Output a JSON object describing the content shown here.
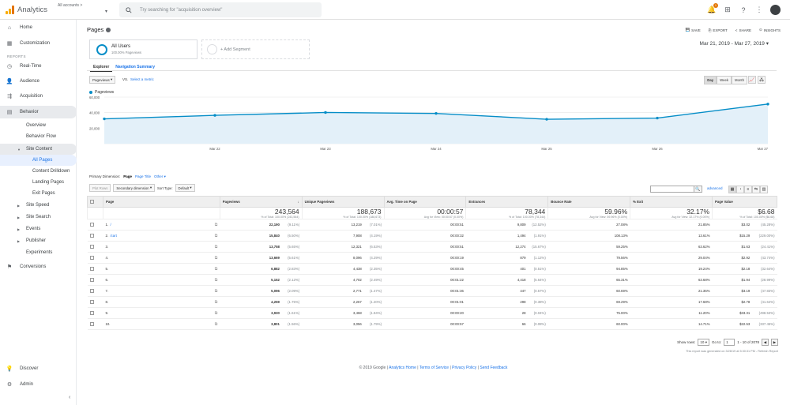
{
  "app": {
    "title": "Analytics",
    "account": "All accounts >"
  },
  "search": {
    "placeholder": "Try searching for \"acquisition overview\""
  },
  "topbar": {
    "badge_count": "1"
  },
  "sidebar": {
    "home": "Home",
    "customization": "Customization",
    "reports_heading": "REPORTS",
    "realtime": "Real-Time",
    "audience": "Audience",
    "acquisition": "Acquisition",
    "behavior": "Behavior",
    "overview": "Overview",
    "behavior_flow": "Behavior Flow",
    "site_content": "Site Content",
    "all_pages": "All Pages",
    "content_drilldown": "Content Drilldown",
    "landing_pages": "Landing Pages",
    "exit_pages": "Exit Pages",
    "site_speed": "Site Speed",
    "site_search": "Site Search",
    "events": "Events",
    "publisher": "Publisher",
    "experiments": "Experiments",
    "conversions": "Conversions",
    "discover": "Discover",
    "admin": "Admin"
  },
  "header": {
    "title": "Pages",
    "save": "SAVE",
    "export": "EXPORT",
    "share": "SHARE",
    "insights": "INSIGHTS",
    "date_range": "Mar 21, 2019 - Mar 27, 2019"
  },
  "segments": {
    "current_name": "All Users",
    "current_sub": "100.00% Pageviews",
    "add_label": "+ Add Segment"
  },
  "tabs": {
    "explorer": "Explorer",
    "navigation_summary": "Navigation Summary"
  },
  "controls": {
    "metric": "Pageviews",
    "vs": "VS.",
    "select_metric": "Select a metric",
    "day": "Day",
    "week": "Week",
    "month": "Month"
  },
  "chart_data": {
    "type": "line",
    "series": [
      {
        "name": "Pageviews",
        "values": [
          32000,
          36500,
          40200,
          39000,
          31500,
          33000,
          51000
        ],
        "color": "#058dc7"
      }
    ],
    "x": [
      "Mar 21",
      "Mar 22",
      "Mar 23",
      "Mar 24",
      "Mar 25",
      "Mar 26",
      "Mar 27"
    ],
    "x_tick_labels": [
      "Mar 22",
      "Mar 23",
      "Mar 24",
      "Mar 25",
      "Mar 26",
      "Mar 27"
    ],
    "y_ticks": [
      "60,000",
      "40,000",
      "20,000"
    ],
    "ylim": [
      0,
      60000
    ],
    "area": true,
    "grid": true
  },
  "dims": {
    "primary_label": "Primary Dimension:",
    "page": "Page",
    "page_title": "Page Title",
    "other": "Other"
  },
  "tools": {
    "plot_rows": "Plot Rows",
    "secondary": "Secondary dimension",
    "sort_label": "Sort Type:",
    "sort_value": "Default",
    "advanced": "advanced"
  },
  "table": {
    "headers": {
      "page": "Page",
      "pageviews": "Pageviews",
      "unique": "Unique Pageviews",
      "avg_time": "Avg. Time on Page",
      "entrances": "Entrances",
      "bounce": "Bounce Rate",
      "exit": "% Exit",
      "value": "Page Value"
    },
    "totals": {
      "pageviews": "243,564",
      "pageviews_sub": "% of Total: 100.00% (243,564)",
      "unique": "188,673",
      "unique_sub": "% of Total: 100.00% (188,673)",
      "avg_time": "00:00:57",
      "avg_time_sub": "Avg for View: 00:00:57 (0.00%)",
      "entrances": "78,344",
      "entrances_sub": "% of Total: 100.00% (78,344)",
      "bounce": "59.96%",
      "bounce_sub": "Avg for View: 59.96% (0.00%)",
      "exit": "32.17%",
      "exit_sub": "Avg for View: 32.17% (0.00%)",
      "value": "$6.68",
      "value_sub": "% of Total: 100.00% ($6.68)"
    },
    "rows": [
      {
        "n": "1.",
        "page": "/",
        "pv": "22,190",
        "pvp": "(9.11%)",
        "up": "13,219",
        "upp": "(7.01%)",
        "time": "00:00:51",
        "ent": "9,809",
        "entp": "(12.52%)",
        "br": "27.08%",
        "ex": "21.85%",
        "val": "$3.02",
        "valp": "(45.28%)"
      },
      {
        "n": "2.",
        "page": "/cart",
        "pv": "15,840",
        "pvp": "(6.50%)",
        "up": "7,908",
        "upp": "(4.19%)",
        "time": "00:00:32",
        "ent": "1,494",
        "entp": "(1.91%)",
        "br": "108.13%",
        "ex": "13.61%",
        "val": "$15.29",
        "valp": "(229.00%)"
      },
      {
        "n": "3.",
        "page": "",
        "pv": "13,758",
        "pvp": "(5.65%)",
        "up": "12,321",
        "upp": "(6.53%)",
        "time": "00:00:51",
        "ent": "12,274",
        "entp": "(15.67%)",
        "br": "59.25%",
        "ex": "63.62%",
        "val": "$1.63",
        "valp": "(24.41%)"
      },
      {
        "n": "4.",
        "page": "",
        "pv": "13,669",
        "pvp": "(5.61%)",
        "up": "8,096",
        "upp": "(4.29%)",
        "time": "00:00:19",
        "ent": "879",
        "entp": "(1.12%)",
        "br": "79.56%",
        "ex": "29.04%",
        "val": "$2.92",
        "valp": "(43.74%)"
      },
      {
        "n": "5.",
        "page": "",
        "pv": "6,882",
        "pvp": "(2.83%)",
        "up": "4,438",
        "upp": "(2.35%)",
        "time": "00:00:45",
        "ent": "401",
        "entp": "(0.51%)",
        "br": "94.85%",
        "ex": "19.24%",
        "val": "$2.18",
        "valp": "(32.64%)"
      },
      {
        "n": "6.",
        "page": "",
        "pv": "5,152",
        "pvp": "(2.12%)",
        "up": "4,702",
        "upp": "(2.49%)",
        "time": "00:01:22",
        "ent": "4,418",
        "entp": "(5.64%)",
        "br": "65.31%",
        "ex": "63.68%",
        "val": "$1.94",
        "valp": "(28.99%)"
      },
      {
        "n": "7.",
        "page": "",
        "pv": "5,096",
        "pvp": "(2.09%)",
        "up": "2,771",
        "upp": "(1.47%)",
        "time": "00:01:36",
        "ent": "447",
        "entp": "(0.57%)",
        "br": "60.69%",
        "ex": "21.35%",
        "val": "$3.19",
        "valp": "(47.83%)"
      },
      {
        "n": "8.",
        "page": "",
        "pv": "4,259",
        "pvp": "(1.75%)",
        "up": "2,267",
        "upp": "(1.20%)",
        "time": "00:01:01",
        "ent": "298",
        "entp": "(0.38%)",
        "br": "69.29%",
        "ex": "17.68%",
        "val": "$2.78",
        "valp": "(41.64%)"
      },
      {
        "n": "9.",
        "page": "",
        "pv": "3,930",
        "pvp": "(1.61%)",
        "up": "3,468",
        "upp": "(1.84%)",
        "time": "00:00:20",
        "ent": "28",
        "entp": "(0.04%)",
        "br": "75.00%",
        "ex": "11.20%",
        "val": "$33.31",
        "valp": "(498.53%)"
      },
      {
        "n": "10.",
        "page": "",
        "pv": "3,801",
        "pvp": "(1.56%)",
        "up": "3,056",
        "upp": "(1.79%)",
        "time": "00:00:57",
        "ent": "66",
        "entp": "(0.08%)",
        "br": "60.00%",
        "ex": "14.71%",
        "val": "$22.53",
        "valp": "(337.45%)"
      }
    ]
  },
  "pager": {
    "show_rows": "Show rows:",
    "rows": "10",
    "goto": "Go to:",
    "goto_val": "1",
    "range": "1 - 10 of 2078",
    "generated": "This report was generated on 3/28/19 at 5:30:31 PM - Refresh Report"
  },
  "footer": {
    "copy": "© 2019 Google |",
    "home": "Analytics Home",
    "tos": "Terms of Service",
    "privacy": "Privacy Policy",
    "feedback": "Send Feedback"
  }
}
